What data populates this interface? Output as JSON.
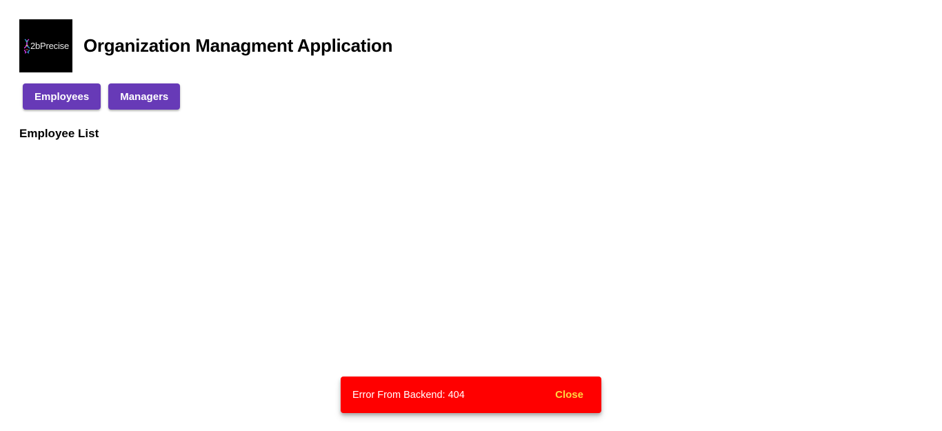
{
  "header": {
    "logo_text": "2bPrecise",
    "title": "Organization Managment Application"
  },
  "nav": {
    "employees_label": "Employees",
    "managers_label": "Managers"
  },
  "main": {
    "section_title": "Employee List"
  },
  "snackbar": {
    "message": "Error From Backend: 404",
    "action_label": "Close"
  },
  "colors": {
    "primary": "#673ab7",
    "snackbar_background": "#ff0000",
    "snackbar_action": "#ffd740",
    "logo_background": "#000000"
  }
}
